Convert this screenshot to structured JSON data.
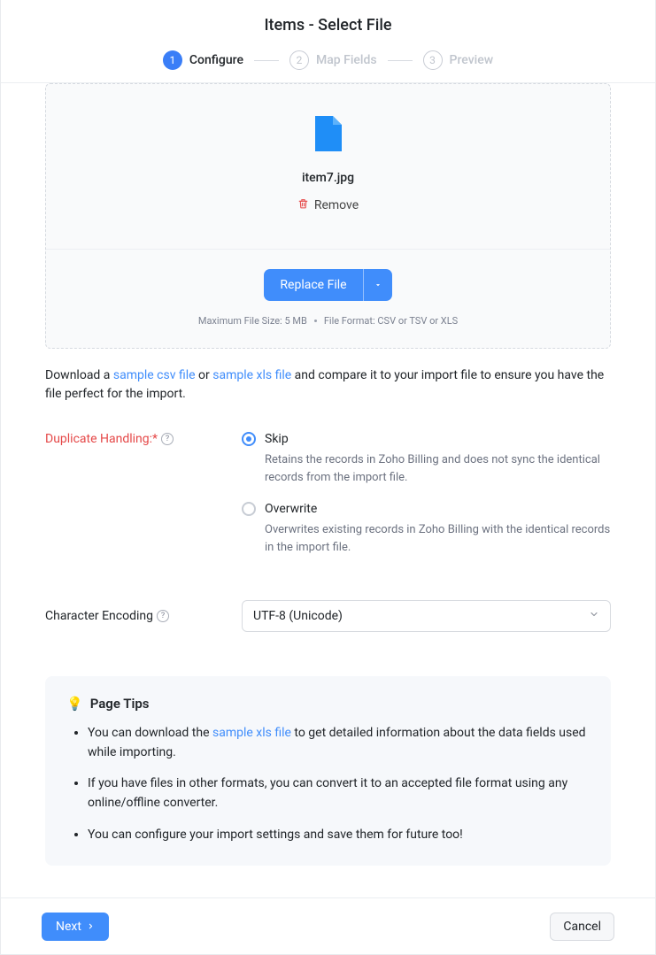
{
  "header": {
    "title": "Items - Select File",
    "steps": {
      "s1": {
        "num": "1",
        "label": "Configure"
      },
      "s2": {
        "num": "2",
        "label": "Map Fields"
      },
      "s3": {
        "num": "3",
        "label": "Preview"
      }
    }
  },
  "drop": {
    "file_name": "item7.jpg",
    "remove_label": "Remove",
    "replace_label": "Replace File",
    "max_hint": "Maximum File Size: 5 MB",
    "fmt_hint": "File Format: CSV or TSV or XLS"
  },
  "download_line": {
    "prefix": "Download a ",
    "csv_link": "sample csv file",
    "or": " or ",
    "xls_link": "sample xls file",
    "suffix": " and compare it to your import file to ensure you have the file perfect for the import."
  },
  "duplicate": {
    "label": "Duplicate Handling:*",
    "skip": {
      "label": "Skip",
      "desc": "Retains the records in Zoho Billing and does not sync the identical records from the import file."
    },
    "overwrite": {
      "label": "Overwrite",
      "desc": "Overwrites existing records in Zoho Billing with the identical records in the import file."
    }
  },
  "encoding": {
    "label": "Character Encoding",
    "value": "UTF-8 (Unicode)"
  },
  "tips": {
    "heading": "Page Tips",
    "t1_prefix": "You can download the ",
    "t1_link": "sample xls file",
    "t1_suffix": " to get detailed information about the data fields used while importing.",
    "t2": "If you have files in other formats, you can convert it to an accepted file format using any online/offline converter.",
    "t3": "You can configure your import settings and save them for future too!"
  },
  "footer": {
    "next": "Next",
    "cancel": "Cancel"
  }
}
